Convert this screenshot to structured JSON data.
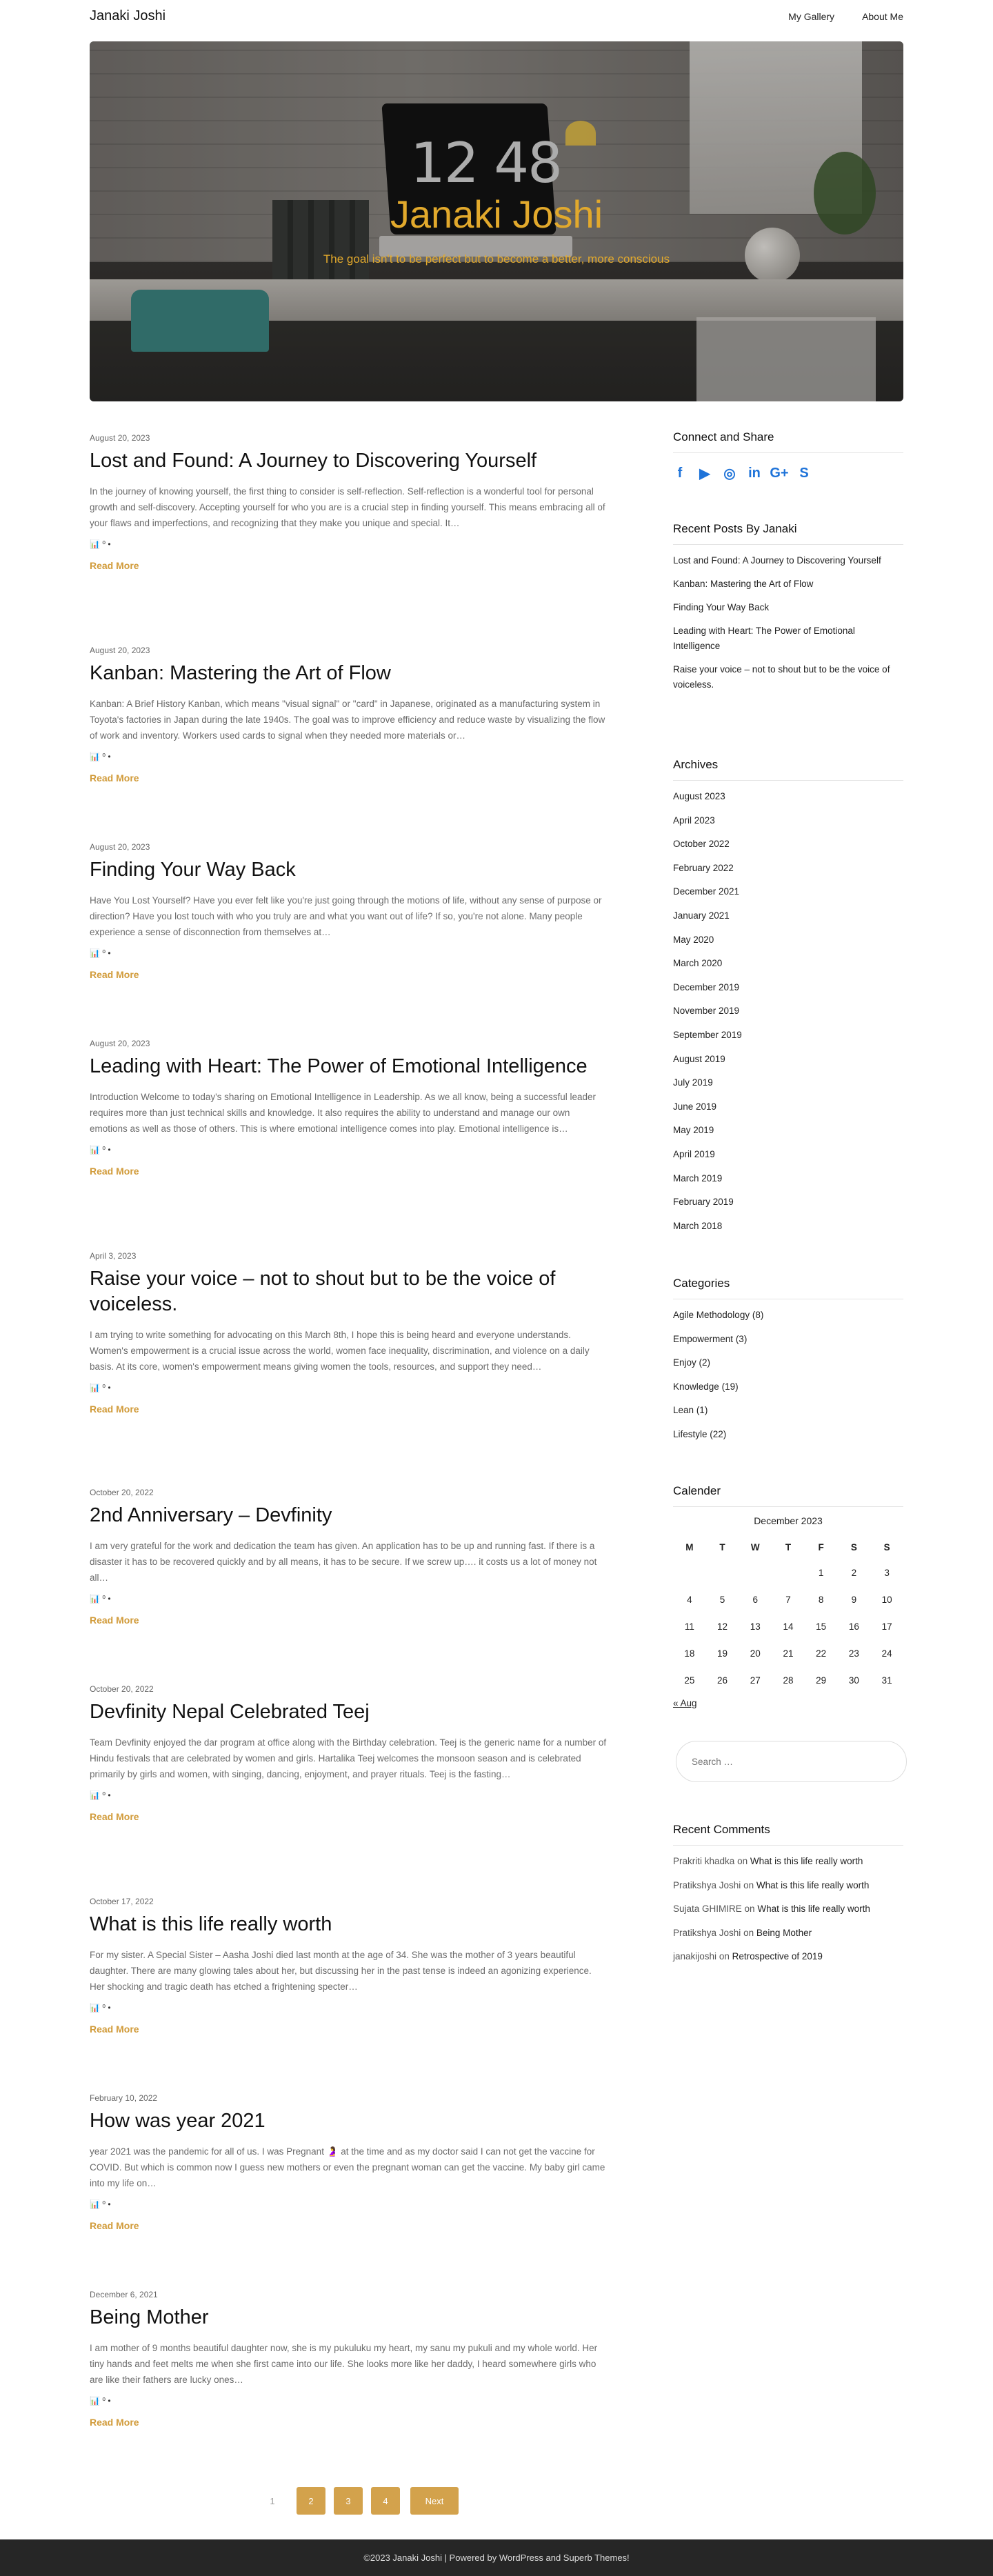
{
  "header": {
    "site_title": "Janaki Joshi",
    "nav": [
      "My Gallery",
      "About Me"
    ]
  },
  "hero": {
    "title": "Janaki Joshi",
    "tagline": "The goal isn't to be perfect but to become a better, more conscious",
    "clock_text": "12 48"
  },
  "posts": [
    {
      "date": "August 20, 2023",
      "title": "Lost and Found: A Journey to Discovering Yourself",
      "excerpt": "In the journey of knowing yourself, the first thing to consider is self-reflection. Self-reflection is a wonderful tool for personal growth and self-discovery. Accepting yourself for who you are is a crucial step in finding yourself. This means embracing all of your flaws and imperfections, and recognizing that they make you unique and special. It…",
      "meta": "📊 ⁰ •",
      "read_more": "Read More"
    },
    {
      "date": "August 20, 2023",
      "title": "Kanban: Mastering the Art of Flow",
      "excerpt": "Kanban: A Brief History Kanban, which means \"visual signal\" or \"card\" in Japanese, originated as a manufacturing system in Toyota's factories in Japan during the late 1940s. The goal was to improve efficiency and reduce waste by visualizing the flow of work and inventory. Workers used cards to signal when they needed more materials or…",
      "meta": "📊 ⁰ •",
      "read_more": "Read More"
    },
    {
      "date": "August 20, 2023",
      "title": "Finding Your Way Back",
      "excerpt": "Have You Lost Yourself? Have you ever felt like you're just going through the motions of life, without any sense of purpose or direction? Have you lost touch with who you truly are and what you want out of life? If so, you're not alone. Many people experience a sense of disconnection from themselves at…",
      "meta": "📊 ⁰ •",
      "read_more": "Read More"
    },
    {
      "date": "August 20, 2023",
      "title": "Leading with Heart: The Power of Emotional Intelligence",
      "excerpt": "Introduction Welcome to today's sharing on Emotional Intelligence in Leadership. As we all know, being a successful leader requires more than just technical skills and knowledge. It also requires the ability to understand and manage our own emotions as well as those of others. This is where emotional intelligence comes into play. Emotional intelligence is…",
      "meta": "📊 ⁰ •",
      "read_more": "Read More"
    },
    {
      "date": "April 3, 2023",
      "title": "Raise your voice – not to shout but to be the voice of voiceless.",
      "excerpt": "I am trying to write something for advocating on this March 8th, I hope this is being heard and everyone understands. Women's empowerment is a crucial issue across the world, women face inequality, discrimination, and violence on a daily basis. At its core, women's empowerment means giving women the tools, resources, and support they need…",
      "meta": "📊 ⁰ •",
      "read_more": "Read More"
    },
    {
      "date": "October 20, 2022",
      "title": "2nd Anniversary – Devfinity",
      "excerpt": "I am very grateful for the work and dedication the team has given. An application has to be up and running fast. If there is a disaster it has to be recovered quickly and by all means, it has to be secure. If we screw up…. it costs us a lot of money not all…",
      "meta": "📊 ⁰ •",
      "read_more": "Read More"
    },
    {
      "date": "October 20, 2022",
      "title": "Devfinity Nepal Celebrated Teej",
      "excerpt": "Team Devfinity enjoyed the dar program at office along with the Birthday celebration. Teej is the generic name for a number of Hindu festivals that are celebrated by women and girls. Hartalika Teej welcomes the monsoon season and is celebrated primarily by girls and women, with singing, dancing, enjoyment, and prayer rituals. Teej is the fasting…",
      "meta": "📊 ⁰ •",
      "read_more": "Read More"
    },
    {
      "date": "October 17, 2022",
      "title": "What is this life really worth",
      "excerpt": "For my sister. A Special Sister – Aasha Joshi died last month at the age of 34. She was the mother of 3 years beautiful daughter. There are many glowing tales about her, but discussing her in the past tense is indeed an agonizing experience. Her shocking and tragic death has etched a frightening specter…",
      "meta": "📊 ⁰ •",
      "read_more": "Read More"
    },
    {
      "date": "February 10, 2022",
      "title": "How was year 2021",
      "excerpt": "year 2021 was the pandemic for all of us. I was Pregnant 🤰 at the time and as my doctor said I can not get the vaccine for COVID. But which is common now I guess new mothers or even the pregnant woman can get the vaccine. My baby girl came into my life on…",
      "meta": "📊 ⁰ •",
      "read_more": "Read More"
    },
    {
      "date": "December 6, 2021",
      "title": "Being Mother",
      "excerpt": "I am mother of 9 months beautiful daughter now, she is my pukuluku my heart, my sanu my pukuli and my whole world. Her tiny hands and feet melts me when she first came into our life. She looks more like her daddy, I heard somewhere girls who are like their fathers are lucky ones…",
      "meta": "📊 ⁰ •",
      "read_more": "Read More"
    }
  ],
  "sidebar": {
    "connect": {
      "title": "Connect and Share",
      "icons": [
        {
          "name": "facebook-icon",
          "glyph": "f",
          "color": "#1e73d9"
        },
        {
          "name": "youtube-icon",
          "glyph": "▶",
          "color": "#1e73d9"
        },
        {
          "name": "instagram-icon",
          "glyph": "◎",
          "color": "#1e73d9"
        },
        {
          "name": "linkedin-icon",
          "glyph": "in",
          "color": "#1e73d9"
        },
        {
          "name": "google-plus-icon",
          "glyph": "G+",
          "color": "#1e73d9"
        },
        {
          "name": "skype-icon",
          "glyph": "S",
          "color": "#1e73d9"
        }
      ]
    },
    "recent_posts": {
      "title": "Recent Posts By Janaki",
      "items": [
        "Lost and Found: A Journey to Discovering Yourself",
        "Kanban: Mastering the Art of Flow",
        "Finding Your Way Back",
        "Leading with Heart: The Power of Emotional Intelligence",
        "Raise your voice – not to shout but to be the voice of voiceless."
      ]
    },
    "archives": {
      "title": "Archives",
      "items": [
        "August 2023",
        "April 2023",
        "October 2022",
        "February 2022",
        "December 2021",
        "January 2021",
        "May 2020",
        "March 2020",
        "December 2019",
        "November 2019",
        "September 2019",
        "August 2019",
        "July 2019",
        "June 2019",
        "May 2019",
        "April 2019",
        "March 2019",
        "February 2019",
        "March 2018"
      ]
    },
    "categories": {
      "title": "Categories",
      "items": [
        {
          "name": "Agile Methodology",
          "count": "(8)"
        },
        {
          "name": "Empowerment",
          "count": "(3)"
        },
        {
          "name": "Enjoy",
          "count": "(2)"
        },
        {
          "name": "Knowledge",
          "count": "(19)"
        },
        {
          "name": "Lean",
          "count": "(1)"
        },
        {
          "name": "Lifestyle",
          "count": "(22)"
        }
      ]
    },
    "calendar": {
      "title": "Calender",
      "caption": "December 2023",
      "weekdays": [
        "M",
        "T",
        "W",
        "T",
        "F",
        "S",
        "S"
      ],
      "weeks": [
        [
          "",
          "",
          "",
          "",
          "1",
          "2",
          "3"
        ],
        [
          "4",
          "5",
          "6",
          "7",
          "8",
          "9",
          "10"
        ],
        [
          "11",
          "12",
          "13",
          "14",
          "15",
          "16",
          "17"
        ],
        [
          "18",
          "19",
          "20",
          "21",
          "22",
          "23",
          "24"
        ],
        [
          "25",
          "26",
          "27",
          "28",
          "29",
          "30",
          "31"
        ]
      ],
      "prev_link": "« Aug"
    },
    "search": {
      "placeholder": "Search …"
    },
    "recent_comments": {
      "title": "Recent Comments",
      "items": [
        {
          "author": "Prakriti khadka",
          "on": "on",
          "post": "What is this life really worth"
        },
        {
          "author": "Pratikshya Joshi",
          "on": "on",
          "post": "What is this life really worth"
        },
        {
          "author": "Sujata GHIMIRE",
          "on": "on",
          "post": "What is this life really worth"
        },
        {
          "author": "Pratikshya Joshi",
          "on": "on",
          "post": "Being Mother"
        },
        {
          "author": "janakijoshi",
          "on": "on",
          "post": "Retrospective of 2019"
        }
      ]
    }
  },
  "pagination": {
    "current": "1",
    "pages": [
      "2",
      "3",
      "4"
    ],
    "next": "Next"
  },
  "footer": {
    "text": "©2023 Janaki Joshi | Powered by WordPress and Superb Themes!"
  },
  "colors": {
    "accent": "#d19b3a",
    "hero_text": "#e2a92c",
    "social_blue": "#1e73d9",
    "footer_bg": "#262626"
  }
}
